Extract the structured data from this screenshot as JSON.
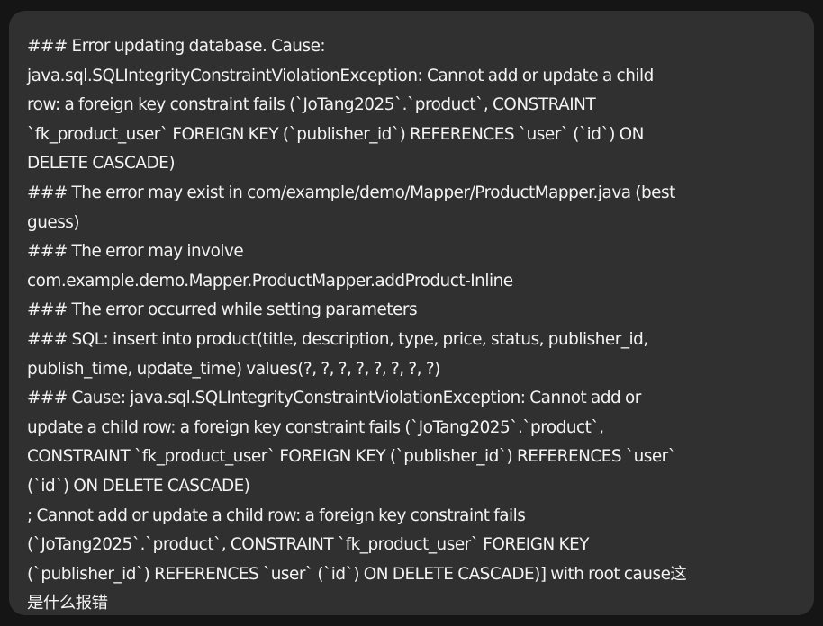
{
  "message": {
    "lines": [
      "### Error updating database.  Cause:",
      "java.sql.SQLIntegrityConstraintViolationException: Cannot add or update a child",
      "row: a foreign key constraint fails (`JoTang2025`.`product`, CONSTRAINT",
      "`fk_product_user` FOREIGN KEY (`publisher_id`) REFERENCES `user` (`id`) ON",
      "DELETE CASCADE)",
      "### The error may exist in com/example/demo/Mapper/ProductMapper.java (best",
      "guess)",
      "### The error may involve",
      "com.example.demo.Mapper.ProductMapper.addProduct-Inline",
      "### The error occurred while setting parameters",
      "### SQL: insert into product(title, description, type, price, status, publisher_id,",
      "publish_time, update_time) values(?, ?, ?, ?, ?, ?, ?, ?)",
      "### Cause: java.sql.SQLIntegrityConstraintViolationException: Cannot add or",
      "update a child row: a foreign key constraint fails (`JoTang2025`.`product`,",
      "CONSTRAINT `fk_product_user` FOREIGN KEY (`publisher_id`) REFERENCES `user`",
      "(`id`) ON DELETE CASCADE)",
      "; Cannot add or update a child row: a foreign key constraint fails",
      "(`JoTang2025`.`product`, CONSTRAINT `fk_product_user` FOREIGN KEY",
      "(`publisher_id`) REFERENCES `user` (`id`) ON DELETE CASCADE)] with root cause这",
      "是什么报错"
    ]
  },
  "colors": {
    "page_background": "#151515",
    "bubble_background": "#303030",
    "text": "#f3f3f3"
  }
}
